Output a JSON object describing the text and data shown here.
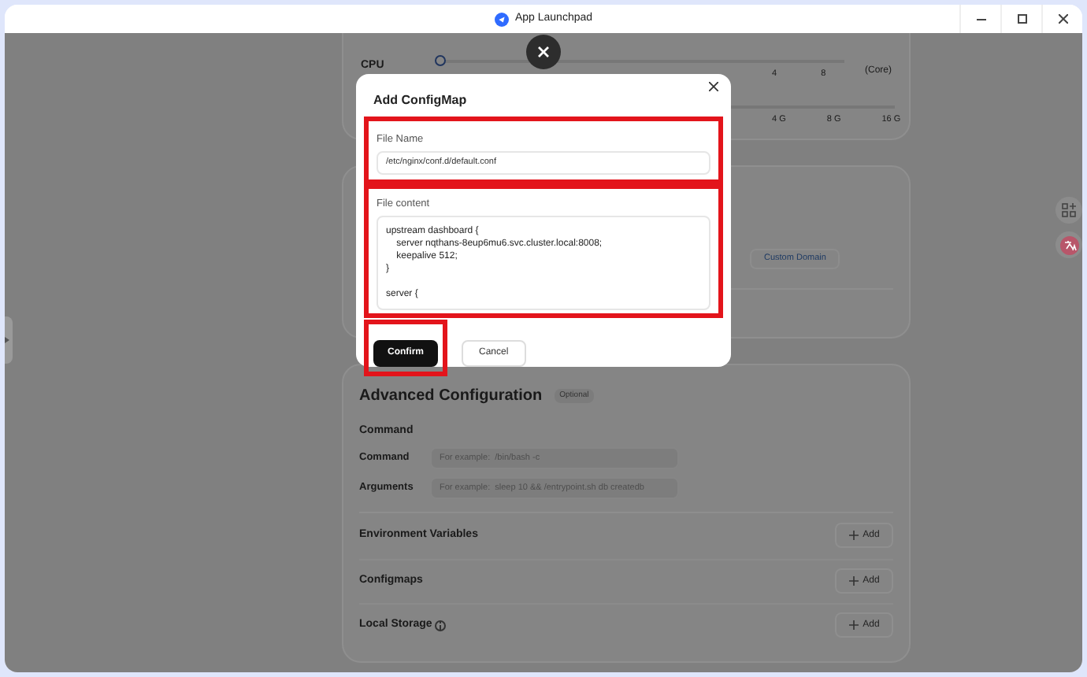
{
  "window": {
    "title": "App Launchpad"
  },
  "resources": {
    "cpu": {
      "label": "CPU",
      "level": 0,
      "ticks": [
        "4",
        "8"
      ],
      "unit": "(Core)"
    },
    "memory": {
      "ticks": [
        "4 G",
        "8 G",
        "16 G"
      ]
    }
  },
  "network": {
    "custom_domain_button": "Custom Domain"
  },
  "advanced": {
    "title": "Advanced Configuration",
    "badge": "Optional",
    "command_heading": "Command",
    "fields": [
      {
        "label": "Command",
        "placeholder": "For example:  /bin/bash -c"
      },
      {
        "label": "Arguments",
        "placeholder": "For example:  sleep 10 && /entrypoint.sh db createdb"
      }
    ],
    "sections": [
      {
        "label": "Environment Variables",
        "info": false,
        "button": "Add"
      },
      {
        "label": "Configmaps",
        "info": false,
        "button": "Add"
      },
      {
        "label": "Local Storage",
        "info": true,
        "button": "Add"
      }
    ]
  },
  "dialog": {
    "title": "Add ConfigMap",
    "file_name": {
      "label": "File Name",
      "value": "/etc/nginx/conf.d/default.conf",
      "highlighted": true
    },
    "file_content": {
      "label": "File content",
      "value": "upstream dashboard {\n    server nqthans-8eup6mu6.svc.cluster.local:8008;\n    keepalive 512;\n}\n\nserver {",
      "highlighted": true
    },
    "buttons": [
      {
        "label": "Confirm",
        "kind": "primary",
        "highlighted": true
      },
      {
        "label": "Cancel",
        "kind": "secondary",
        "highlighted": false
      }
    ]
  }
}
